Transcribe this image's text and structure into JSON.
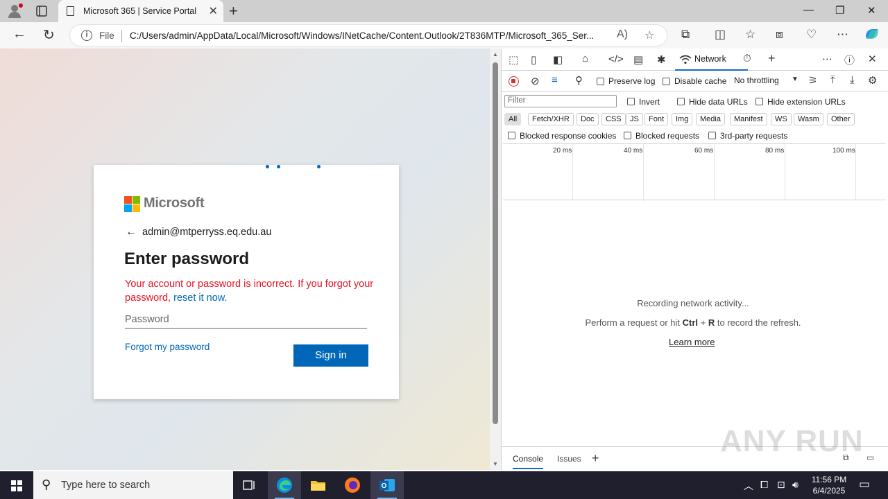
{
  "browser": {
    "tab_title": "Microsoft 365 | Service Portal",
    "url_scheme": "File",
    "url": "C:/Users/admin/AppData/Local/Microsoft/Windows/INetCache/Content.Outlook/2T836MTP/Microsoft_365_Ser..."
  },
  "login": {
    "brand": "Microsoft",
    "identity": "admin@mtperryss.eq.edu.au",
    "heading": "Enter password",
    "error_text": "Your account or password is incorrect. If you forgot your password, ",
    "error_link": "reset it now.",
    "password_placeholder": "Password",
    "forgot_label": "Forgot my password",
    "signin_label": "Sign in",
    "logo_colors": [
      "#f25022",
      "#7fba00",
      "#00a4ef",
      "#ffb900"
    ]
  },
  "devtools": {
    "active_tab": "Network",
    "preserve_log": "Preserve log",
    "disable_cache": "Disable cache",
    "throttling": "No throttling",
    "filter_placeholder": "Filter",
    "invert": "Invert",
    "hide_data_urls": "Hide data URLs",
    "hide_extension_urls": "Hide extension URLs",
    "filter_chips": [
      "All",
      "Fetch/XHR",
      "Doc",
      "CSS",
      "JS",
      "Font",
      "Img",
      "Media",
      "Manifest",
      "WS",
      "Wasm",
      "Other"
    ],
    "blocked_cookies": "Blocked response cookies",
    "blocked_requests": "Blocked requests",
    "third_party": "3rd-party requests",
    "timeline_labels": [
      "20 ms",
      "40 ms",
      "60 ms",
      "80 ms",
      "100 ms"
    ],
    "empty_line1": "Recording network activity...",
    "empty_line2_pre": "Perform a request or hit ",
    "empty_key1": "Ctrl",
    "empty_plus": " + ",
    "empty_key2": "R",
    "empty_line2_post": " to record the refresh.",
    "learn_more": "Learn more",
    "drawer_tabs": [
      "Console",
      "Issues"
    ]
  },
  "taskbar": {
    "search_placeholder": "Type here to search",
    "time": "11:56 PM",
    "date": "6/4/2025"
  },
  "watermark": "ANY RUN"
}
